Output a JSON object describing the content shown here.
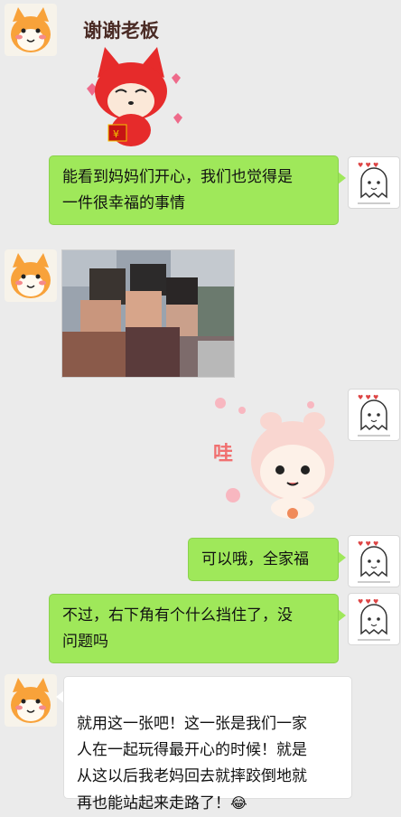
{
  "conversation": {
    "messages": [
      {
        "side": "left",
        "type": "sticker",
        "sticker_text": "谢谢老板"
      },
      {
        "side": "right",
        "type": "text",
        "text": "能看到妈妈们开心，我们也觉得是\n一件很幸福的事情"
      },
      {
        "side": "left",
        "type": "image"
      },
      {
        "side": "right",
        "type": "sticker",
        "sticker_text": "哇"
      },
      {
        "side": "right",
        "type": "text",
        "text": "可以哦，全家福"
      },
      {
        "side": "right",
        "type": "text",
        "text": "不过，右下角有个什么挡住了，没\n问题吗"
      },
      {
        "side": "left",
        "type": "text",
        "text": "就用这一张吧！这一张是我们一家\n人在一起玩得最开心的时候！就是\n从这以后我老妈回去就摔跤倒地就\n再也能站起来走路了！",
        "emoji": "😂"
      }
    ]
  },
  "colors": {
    "background": "#ebebeb",
    "sent_bubble": "#9fe85a",
    "received_bubble": "#ffffff"
  },
  "icons": {
    "left_avatar": "cat-avatar-icon",
    "right_avatar": "ghost-avatar-icon"
  }
}
